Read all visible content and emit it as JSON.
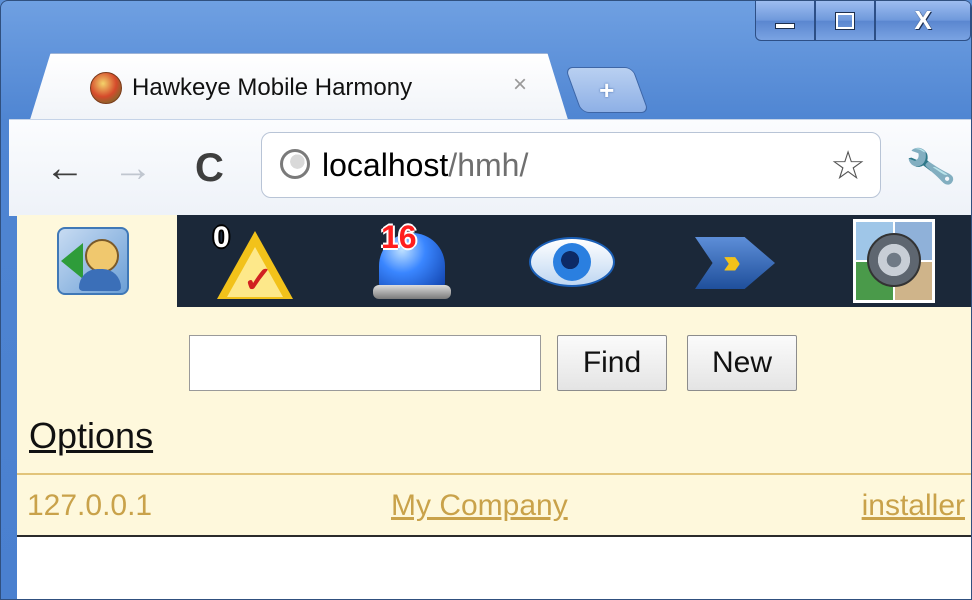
{
  "browser": {
    "tab_title": "Hawkeye Mobile Harmony",
    "tab_close": "×",
    "new_tab": "+",
    "url_host": "localhost",
    "url_path": "/hmh/",
    "window_controls": {
      "minimize": "minimize",
      "maximize": "maximize",
      "close": "X"
    }
  },
  "icon_bar": {
    "icons": [
      {
        "name": "people-back-icon"
      },
      {
        "name": "warning-check-icon",
        "badge": "0"
      },
      {
        "name": "siren-icon",
        "badge": "16"
      },
      {
        "name": "eye-icon"
      },
      {
        "name": "arrows-forward-icon"
      },
      {
        "name": "camera-icon"
      }
    ],
    "dark_color": "#1b2839"
  },
  "search": {
    "value": "",
    "find_label": "Find",
    "new_label": "New"
  },
  "options_label": "Options",
  "status": {
    "ip": "127.0.0.1",
    "company": "My Company",
    "user": "installer"
  },
  "colors": {
    "page_bg": "#fef8dc",
    "status_text": "#c9a24a",
    "chrome_blue": "#4a80cf"
  }
}
